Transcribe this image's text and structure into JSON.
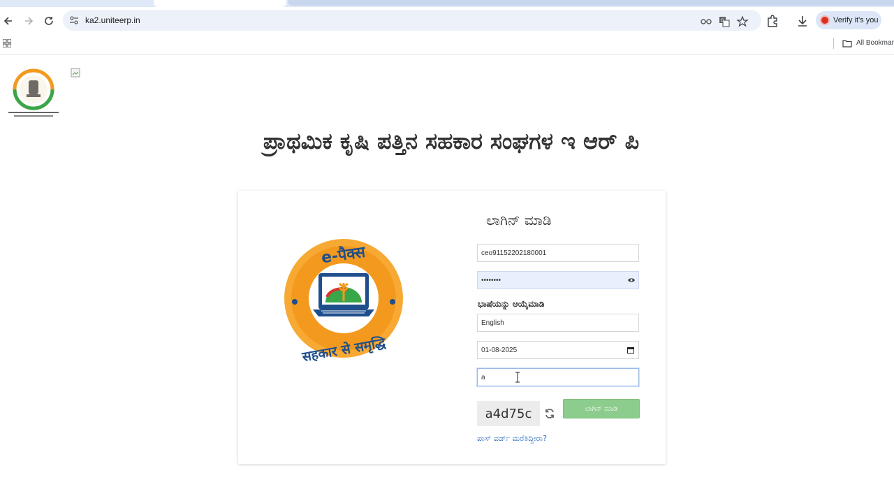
{
  "browser": {
    "url": "ka2.uniteerp.in",
    "profile_label": "Verify it's you",
    "bookmarks_label": "All Bookmar"
  },
  "page": {
    "title": "ಪ್ರಾಥಮಿಕ ಕೃಷಿ ಪತ್ತಿನ ಸಹಕಾರ ಸಂಘಗಳ ಇ ಆರ್ ಪಿ",
    "logo_text_top": "e-पैक्स",
    "logo_text_bottom": "सहकार से समृद्धि"
  },
  "login": {
    "heading": "ಲಾಗಿನ್ ಮಾಡಿ",
    "username_value": "ceo91152202180001",
    "password_value": "••••••••",
    "language_label": "ಭಾಷೆಯನ್ನು ಆಯ್ಕೆಮಾಡಿ",
    "language_value": "English",
    "date_value": "01-08-2025",
    "captcha_input_value": "a",
    "captcha_text": "a4d75c",
    "login_button": "ಲಾಗಿನ್ ಮಾಡಿ",
    "forgot_password": "ಪಾಸ್ ವರ್ಡ್ ಮರೆತಿದ್ದೀರಾ?"
  },
  "colors": {
    "logo_orange": "#f39a1e",
    "logo_blue": "#1f4e8c",
    "button_green": "#8ccc8c",
    "link_blue": "#3070c0"
  }
}
